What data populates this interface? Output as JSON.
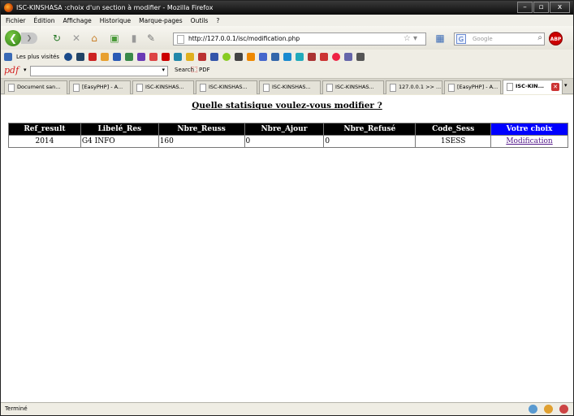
{
  "window": {
    "title": "ISC-KINSHASA :choix d'un section à modifier - Mozilla Firefox",
    "minimize": "–",
    "maximize": "▫",
    "close": "x"
  },
  "menu": [
    "Fichier",
    "Édition",
    "Affichage",
    "Historique",
    "Marque-pages",
    "Outils",
    "?"
  ],
  "nav": {
    "url": "http://127.0.0.1/isc/modification.php",
    "search_placeholder": "Google"
  },
  "bookmarks": {
    "most_visited": "Les plus visités"
  },
  "pdf_toolbar": {
    "search_label": "Search",
    "pdf_label": "PDF"
  },
  "tabs": [
    "Document san...",
    "[EasyPHP] - A...",
    "ISC-KINSHAS...",
    "ISC-KINSHAS...",
    "ISC-KINSHAS...",
    "ISC-KINSHAS...",
    "127.0.0.1 >> ...",
    "[EasyPHP] - A...",
    "ISC-KIN..."
  ],
  "page": {
    "heading": "Quelle statisique voulez-vous modifier ?",
    "columns": [
      "Ref_result",
      "Libelé_Res",
      "Nbre_Reuss",
      "Nbre_Ajour",
      "Nbre_Refusé",
      "Code_Sess",
      "Votre choix"
    ],
    "rows": [
      {
        "ref": "2014",
        "libelle": "G4 INFO",
        "reuss": "160",
        "ajour": "0",
        "refuse": "0",
        "sess": "1SESS",
        "action": "Modification"
      }
    ]
  },
  "status": {
    "text": "Terminé"
  },
  "colors": {
    "choice_header": "#0000ff",
    "header_bg": "#000000",
    "link": "#551a8b"
  }
}
